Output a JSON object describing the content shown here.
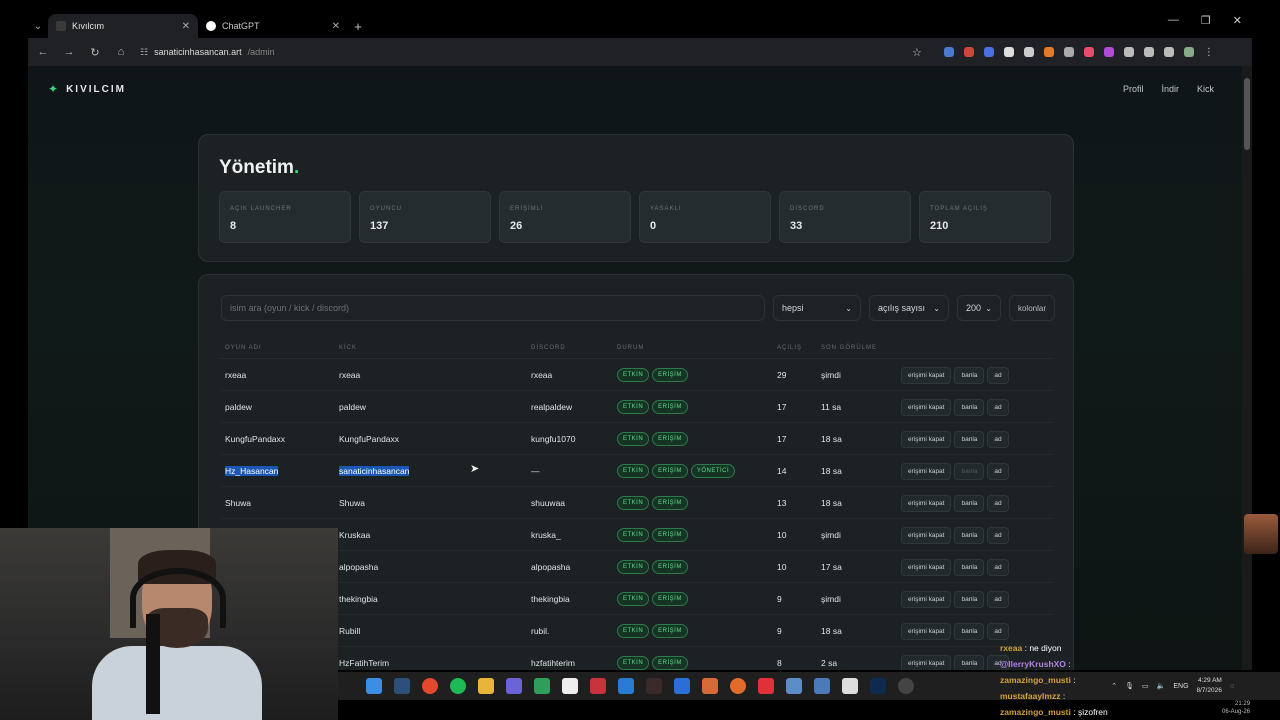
{
  "browser": {
    "tabs": [
      {
        "title": "Kıvılcım",
        "active": true
      },
      {
        "title": "ChatGPT",
        "active": false
      }
    ],
    "url_host": "sanaticinhasancan.art",
    "url_path": "/admin"
  },
  "site": {
    "brand": "KIVILCIM",
    "nav": [
      "Profil",
      "İndir",
      "Kick"
    ]
  },
  "admin": {
    "title": "Yönetim",
    "title_dot": ".",
    "stats": [
      {
        "label": "AÇIK LAUNCHER",
        "value": "8"
      },
      {
        "label": "OYUNCU",
        "value": "137"
      },
      {
        "label": "ERİŞİMLİ",
        "value": "26"
      },
      {
        "label": "YASAKLI",
        "value": "0"
      },
      {
        "label": "DİSCORD",
        "value": "33"
      },
      {
        "label": "TOPLAM AÇILIŞ",
        "value": "210"
      }
    ],
    "filters": {
      "search_placeholder": "isim ara (oyun / kick / discord)",
      "status_select": "hepsi",
      "sort_select": "açılış sayısı",
      "limit_select": "200",
      "columns_button": "kolonlar"
    },
    "columns": [
      "OYUN ADI",
      "KİCK",
      "DİSCORD",
      "DURUM",
      "AÇILIŞ",
      "SON GÖRÜLME"
    ],
    "actions": {
      "revoke": "erişimi kapat",
      "ban": "banla",
      "name": "ad"
    },
    "rows": [
      {
        "name": "rxeaa",
        "kick": "rxeaa",
        "discord": "rxeaa",
        "badges": [
          "ETKİN",
          "ERİŞİM"
        ],
        "opens": "29",
        "seen": "şimdi"
      },
      {
        "name": "paldew",
        "kick": "paldew",
        "discord": "realpaldew",
        "badges": [
          "ETKİN",
          "ERİŞİM"
        ],
        "opens": "17",
        "seen": "11 sa"
      },
      {
        "name": "KungfuPandaxx",
        "kick": "KungfuPandaxx",
        "discord": "kungfu1070",
        "badges": [
          "ETKİN",
          "ERİŞİM"
        ],
        "opens": "17",
        "seen": "18 sa"
      },
      {
        "name": "Hz_Hasancan",
        "kick": "sanaticinhasancan",
        "discord": "—",
        "badges": [
          "ETKİN",
          "ERİŞİM",
          "YÖNETİCİ"
        ],
        "opens": "14",
        "seen": "18 sa"
      },
      {
        "name": "Shuwa",
        "kick": "Shuwa",
        "discord": "shuuwaa",
        "badges": [
          "ETKİN",
          "ERİŞİM"
        ],
        "opens": "13",
        "seen": "18 sa"
      },
      {
        "name": "",
        "kick": "Kruskaa",
        "discord": "kruska_",
        "badges": [
          "ETKİN",
          "ERİŞİM"
        ],
        "opens": "10",
        "seen": "şimdi"
      },
      {
        "name": "",
        "kick": "alpopasha",
        "discord": "alpopasha",
        "badges": [
          "ETKİN",
          "ERİŞİM"
        ],
        "opens": "10",
        "seen": "17 sa"
      },
      {
        "name": "",
        "kick": "thekingbia",
        "discord": "thekingbia",
        "badges": [
          "ETKİN",
          "ERİŞİM"
        ],
        "opens": "9",
        "seen": "şimdi"
      },
      {
        "name": "",
        "kick": "Rubill",
        "discord": "rubil.",
        "badges": [
          "ETKİN",
          "ERİŞİM"
        ],
        "opens": "9",
        "seen": "18 sa"
      },
      {
        "name": "",
        "kick": "HzFatihTerim",
        "discord": "hzfatihterim",
        "badges": [
          "ETKİN",
          "ERİŞİM"
        ],
        "opens": "8",
        "seen": "2 sa"
      }
    ]
  },
  "chat": [
    {
      "user": "rxeaa",
      "message": "ne diyon",
      "color": "#d4a13d"
    },
    {
      "user": "@IlerryKrushXO",
      "message": "",
      "color": "#b480e8"
    },
    {
      "user": "zamazingo_musti",
      "message": "",
      "color": "#d4a13d"
    },
    {
      "user": "mustafaaylmzz",
      "message": "",
      "color": "#d4a13d"
    },
    {
      "user": "zamazingo_musti",
      "message": "şizofren",
      "color": "#d4a13d"
    }
  ],
  "system": {
    "time": "4:29 AM",
    "date": "8/7/2026",
    "lang": "ENG",
    "time2": "21:29",
    "date2": "06-Aug-26"
  },
  "colors": {
    "accent": "#39d37a",
    "selection": "#1b56b3"
  }
}
